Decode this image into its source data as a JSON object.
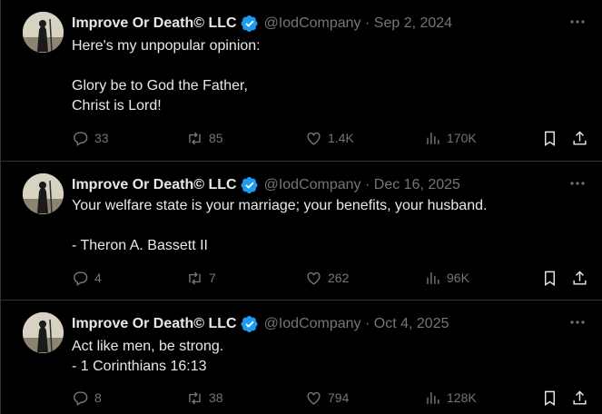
{
  "tweets": [
    {
      "name": "Improve Or Death© LLC",
      "handle_date": "@IodCompany · Sep 2, 2024",
      "text": "Here's my unpopular opinion:\n\nGlory be to God the Father,\nChrist is Lord!",
      "replies": "33",
      "reposts": "85",
      "likes": "1.4K",
      "views": "170K"
    },
    {
      "name": "Improve Or Death© LLC",
      "handle_date": "@IodCompany · Dec 16, 2025",
      "text": "Your welfare state is your marriage; your benefits, your husband.\n\n- Theron A. Bassett II",
      "replies": "4",
      "reposts": "7",
      "likes": "262",
      "views": "96K"
    },
    {
      "name": "Improve Or Death© LLC",
      "handle_date": "@IodCompany · Oct 4, 2025",
      "text": "Act like men, be strong.\n- 1 Corinthians 16:13",
      "replies": "8",
      "reposts": "38",
      "likes": "794",
      "views": "128K"
    }
  ],
  "icons": {
    "verified": "verified-badge-icon",
    "more": "more-icon",
    "reply": "reply-icon",
    "repost": "repost-icon",
    "like": "heart-icon",
    "views": "views-chart-icon",
    "bookmark": "bookmark-icon",
    "share": "share-icon"
  },
  "colors": {
    "background": "#000000",
    "text": "#e7e9ea",
    "secondary": "#71767b",
    "verified": "#1d9bf0",
    "divider": "#2f3336"
  }
}
